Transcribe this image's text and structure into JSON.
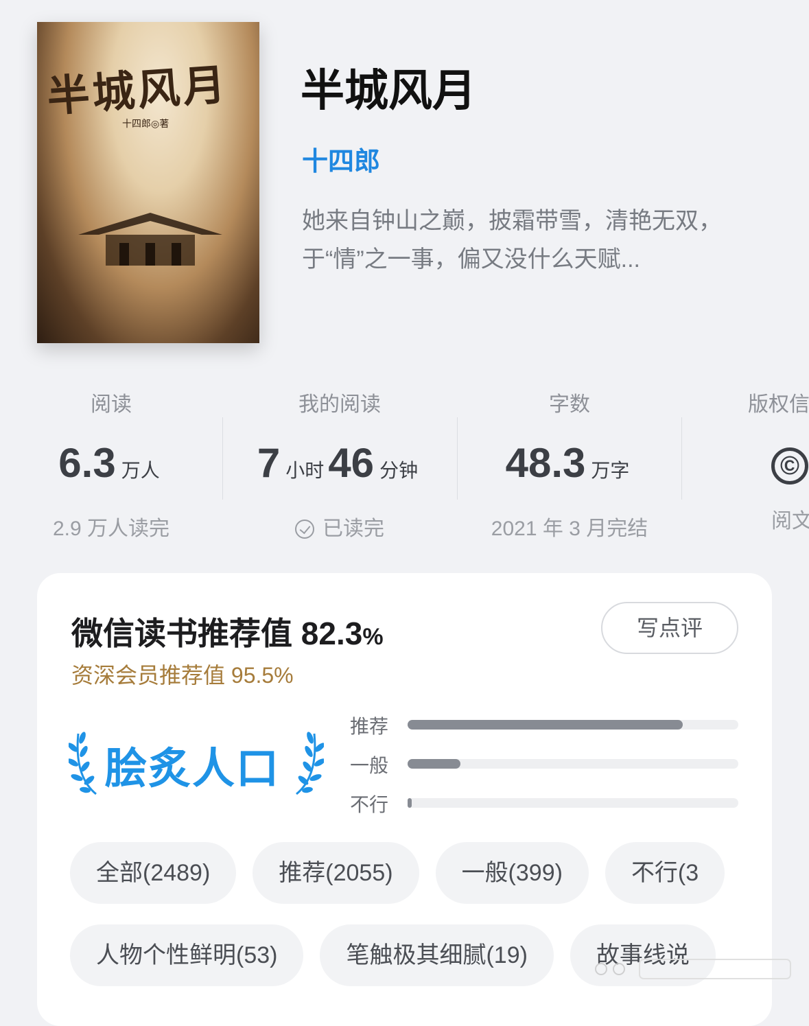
{
  "book": {
    "cover": {
      "title_art": "半城风月",
      "author_line": "十四郎◎著",
      "description": "book cover illustration"
    },
    "title": "半城风月",
    "author": "十四郎",
    "intro": "她来自钟山之巅，披霜带雪，清艳无双，于“情”之一事，偏又没什么天赋..."
  },
  "stats": [
    {
      "label": "阅读",
      "value_parts": [
        {
          "num": "6.3",
          "unit": "万人"
        }
      ],
      "sub": "2.9 万人读完"
    },
    {
      "label": "我的阅读",
      "value_parts": [
        {
          "num": "7",
          "unit": "小时"
        },
        {
          "num": "46",
          "unit": "分钟"
        }
      ],
      "sub": "已读完",
      "sub_icon": "check-circle-icon"
    },
    {
      "label": "字数",
      "value_parts": [
        {
          "num": "48.3",
          "unit": "万字"
        }
      ],
      "sub": "2021 年 3 月完结"
    },
    {
      "label": "版权信",
      "icon": "copyright-icon",
      "icon_glyph": "©",
      "sub": "阅文"
    }
  ],
  "rating": {
    "title": "微信读书推荐值 82.3",
    "title_pct": "%",
    "vip": "资深会员推荐值 95.5%",
    "write_button": "写点评",
    "badge_text": "脍炙人口",
    "distribution": [
      {
        "label": "推荐",
        "fraction": 0.832
      },
      {
        "label": "一般",
        "fraction": 0.16
      },
      {
        "label": "不行",
        "fraction": 0.012
      }
    ],
    "chips_row1": [
      "全部(2489)",
      "推荐(2055)",
      "一般(399)",
      "不行(3"
    ],
    "chips_row2": [
      "人物个性鲜明(53)",
      "笔触极其细腻(19)",
      "故事线说"
    ]
  },
  "colors": {
    "accent_blue": "#1f87e0",
    "badge_blue": "#1f93e6",
    "vip_gold": "#a67c3b",
    "bar_fill": "#878b93",
    "page_bg": "#f1f2f5"
  }
}
